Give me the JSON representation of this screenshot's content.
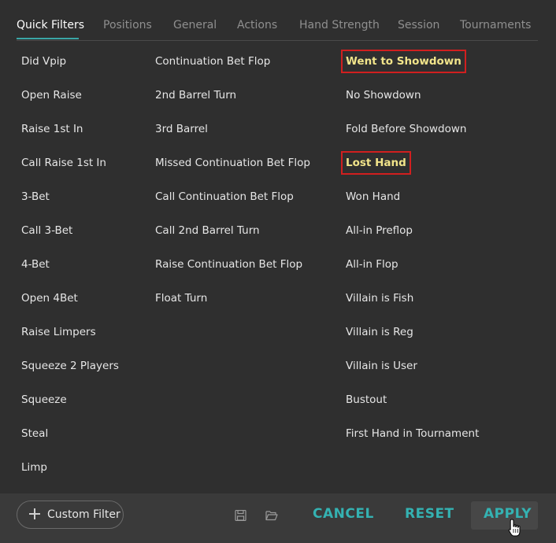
{
  "tabs": [
    "Quick Filters",
    "Positions",
    "General",
    "Actions",
    "Hand Strength",
    "Session",
    "Tournaments"
  ],
  "col1": [
    "Did Vpip",
    "Open Raise",
    "Raise 1st In",
    "Call Raise 1st In",
    "3-Bet",
    "Call 3-Bet",
    "4-Bet",
    "Open 4Bet",
    "Raise Limpers",
    "Squeeze 2 Players",
    "Squeeze",
    "Steal",
    "Limp"
  ],
  "col2": [
    "Continuation Bet Flop",
    "2nd Barrel Turn",
    "3rd Barrel",
    "Missed Continuation Bet Flop",
    "Call Continuation Bet Flop",
    "Call 2nd Barrel Turn",
    "Raise Continuation Bet Flop",
    "Float Turn"
  ],
  "col3": [
    "Went to Showdown",
    "No Showdown",
    "Fold Before Showdown",
    "Lost Hand",
    "Won Hand",
    "All-in Preflop",
    "All-in Flop",
    "Villain is Fish",
    "Villain is Reg",
    "Villain is User",
    "Bustout",
    "First Hand in Tournament"
  ],
  "footer": {
    "custom_filter": "Custom Filter",
    "cancel": "CANCEL",
    "reset": "RESET",
    "apply": "APPLY"
  },
  "icons": {
    "save": "save-icon",
    "open": "folder-open-icon",
    "cursor": "hand-pointer-icon"
  },
  "colors": {
    "accent": "#34b2b2",
    "highlight_text": "#f1e48a",
    "highlight_border": "#d11f1f"
  }
}
